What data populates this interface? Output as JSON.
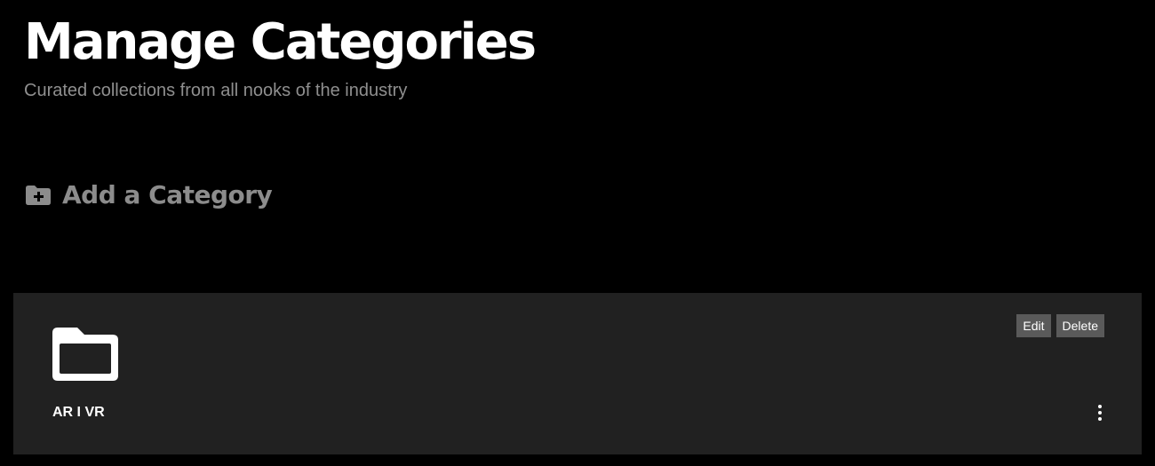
{
  "header": {
    "title": "Manage Categories",
    "subtitle": "Curated collections from all nooks of the industry"
  },
  "add_category": {
    "icon": "folder-plus-icon",
    "label": "Add a Category"
  },
  "categories": [
    {
      "icon": "folder-icon",
      "name": "AR I VR",
      "edit_label": "Edit",
      "delete_label": "Delete",
      "menu_icon": "more-vertical-icon"
    }
  ],
  "colors": {
    "background": "#000000",
    "card": "#212121",
    "muted_text": "#8f8f8f",
    "button": "#5a5a5a"
  }
}
